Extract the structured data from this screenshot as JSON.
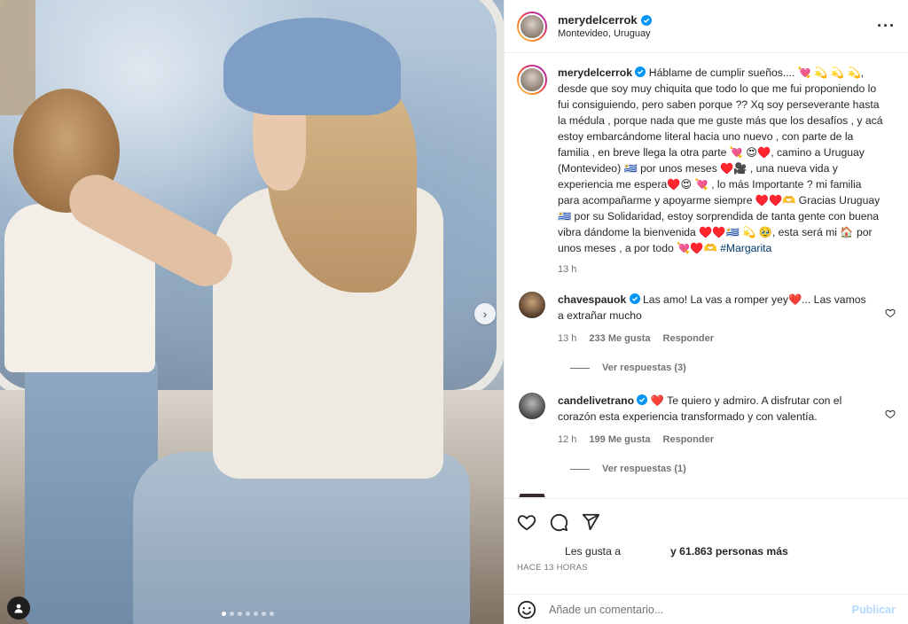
{
  "post": {
    "username": "merydelcerrok",
    "location": "Montevideo, Uruguay",
    "more_icon": "more-horizontal-icon",
    "caption_username": "merydelcerrok",
    "caption_text": "Háblame de cumplir sueños.... 💘 💫 💫 💫, desde que soy muy chiquita que todo lo que me fui proponiendo lo fui consiguiendo, pero saben porque ?? Xq soy perseverante hasta la médula , porque nada que me guste más que los desafíos , y acá estoy embarcándome literal hacia uno nuevo , con parte de la familia , en breve llega la otra parte 💘 😍♥️, camino a Uruguay (Montevideo) 🇺🇾 por unos meses ♥️🎥 , una nueva vida y experiencia me espera♥️😍 💘 , lo más Importante ? mi familia para acompañarme y apoyarme siempre ♥️♥️🫶 Gracias Uruguay 🇺🇾 por su Solidaridad, estoy sorprendida de tanta gente con buena vibra dándome la bienvenida ♥️♥️🇺🇾 💫 🥹, esta será mi 🏠 por unos meses , a por todo 💘♥️🫶",
    "hashtag": "#Margarita",
    "time": "13 h"
  },
  "comments": [
    {
      "username": "chavespauok",
      "text": "Las amo! La vas a romper yey❤️... Las vamos a extrañar mucho",
      "time": "13 h",
      "likes": "233 Me gusta",
      "reply": "Responder",
      "view_replies": "Ver respuestas (3)"
    },
    {
      "username": "candelivetrano",
      "text": "❤️ Te quiero y admiro. A disfrutar con el corazón esta experiencia transformado y con valentía.",
      "time": "12 h",
      "likes": "199 Me gusta",
      "reply": "Responder",
      "view_replies": "Ver respuestas (1)"
    }
  ],
  "likes": {
    "prefix": "Les gusta a",
    "count": "y 61.863 personas más"
  },
  "posted_ago": "HACE 13 HORAS",
  "add_comment": {
    "placeholder": "Añade un comentario...",
    "publish": "Publicar"
  },
  "colors": {
    "verified": "#0095f6",
    "hashtag": "#00376b",
    "publish_disabled": "#b3dbff",
    "muted": "#737373"
  },
  "carousel": {
    "slides": 7,
    "active_slide": 1
  }
}
